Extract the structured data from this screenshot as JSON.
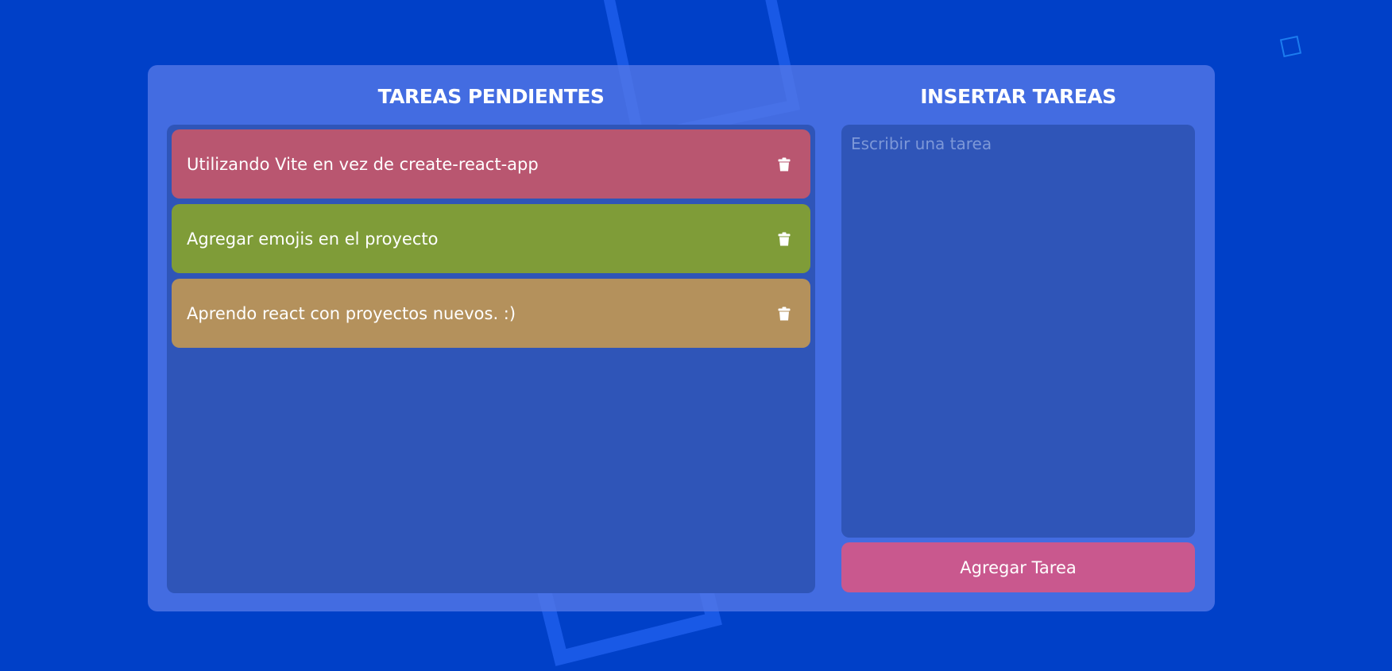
{
  "colors": {
    "background": "#0040c8",
    "card": "#5276e6",
    "panel": "#2f55b8",
    "button": "#c9588e",
    "placeholder": "#7d98d8"
  },
  "pending": {
    "title": "TAREAS PENDIENTES",
    "tasks": [
      {
        "text": "Utilizando Vite en vez de create-react-app",
        "color": "#b95670",
        "icon": "trash-icon"
      },
      {
        "text": "Agregar emojis en el proyecto",
        "color": "#7f9c38",
        "icon": "trash-icon"
      },
      {
        "text": "Aprendo react con proyectos nuevos. :)",
        "color": "#b4915c",
        "icon": "trash-icon"
      }
    ]
  },
  "insert": {
    "title": "INSERTAR TAREAS",
    "placeholder": "Escribir una tarea",
    "value": "",
    "button_label": "Agregar Tarea"
  }
}
